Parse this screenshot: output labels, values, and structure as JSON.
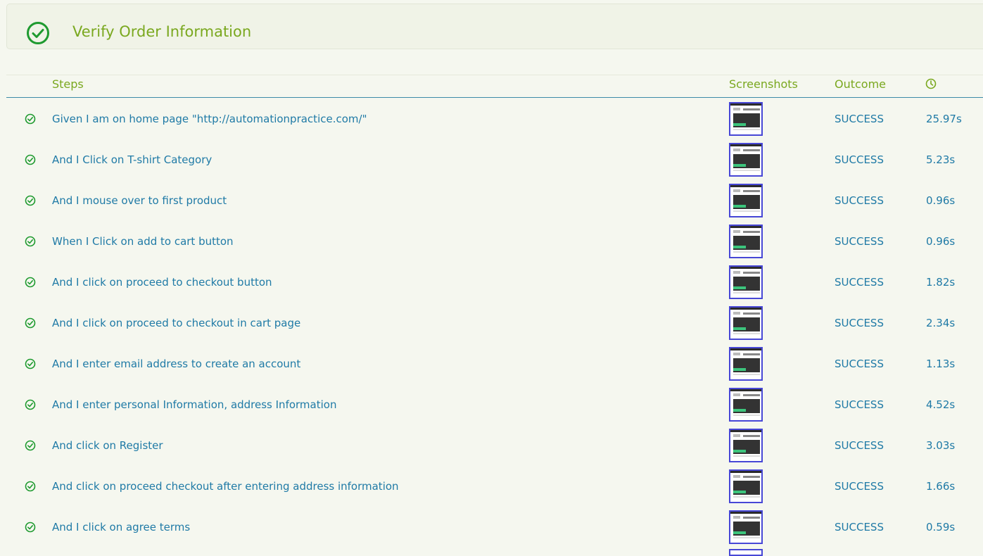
{
  "title": "Verify Order Information",
  "colors": {
    "success": "#1e9a2f",
    "accent": "#7aa81f",
    "link": "#1f7aa6"
  },
  "headers": {
    "steps": "Steps",
    "screenshots": "Screenshots",
    "outcome": "Outcome",
    "duration_icon": "clock-icon"
  },
  "steps": [
    {
      "text": "Given I am on home page \"http://automationpractice.com/\"",
      "outcome": "SUCCESS",
      "duration": "25.97s"
    },
    {
      "text": "And I Click on T-shirt Category",
      "outcome": "SUCCESS",
      "duration": "5.23s"
    },
    {
      "text": "And I mouse over to first product",
      "outcome": "SUCCESS",
      "duration": "0.96s"
    },
    {
      "text": "When I Click on add to cart button",
      "outcome": "SUCCESS",
      "duration": "0.96s"
    },
    {
      "text": "And I click on proceed to checkout button",
      "outcome": "SUCCESS",
      "duration": "1.82s"
    },
    {
      "text": "And I click on proceed to checkout in cart page",
      "outcome": "SUCCESS",
      "duration": "2.34s"
    },
    {
      "text": "And I enter email address to create an account",
      "outcome": "SUCCESS",
      "duration": "1.13s"
    },
    {
      "text": "And I enter personal Information, address Information",
      "outcome": "SUCCESS",
      "duration": "4.52s"
    },
    {
      "text": "And click on Register",
      "outcome": "SUCCESS",
      "duration": "3.03s"
    },
    {
      "text": "And click on proceed checkout after entering address information",
      "outcome": "SUCCESS",
      "duration": "1.66s"
    },
    {
      "text": "And I click on agree terms",
      "outcome": "SUCCESS",
      "duration": "0.59s"
    }
  ]
}
